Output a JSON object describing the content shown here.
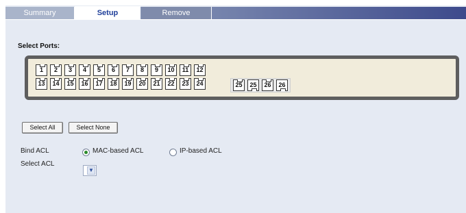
{
  "tabs": [
    {
      "label": "Summary",
      "active": false
    },
    {
      "label": "Setup",
      "active": true
    },
    {
      "label": "Remove",
      "active": false
    }
  ],
  "select_ports": {
    "title": "Select Ports:",
    "row1": [
      "1",
      "2",
      "3",
      "4",
      "5",
      "6",
      "7",
      "8",
      "9",
      "10",
      "11",
      "12"
    ],
    "row2": [
      "13",
      "14",
      "15",
      "16",
      "17",
      "18",
      "19",
      "20",
      "21",
      "22",
      "23",
      "24"
    ],
    "combo": [
      "25",
      "25",
      "26",
      "26"
    ]
  },
  "buttons": {
    "select_all": "Select All",
    "select_none": "Select None"
  },
  "bind_acl": {
    "label": "Bind ACL",
    "options": [
      {
        "label": "MAC-based ACL",
        "selected": true
      },
      {
        "label": "IP-based ACL",
        "selected": false
      }
    ]
  },
  "select_acl": {
    "label": "Select ACL",
    "value": ""
  },
  "colors": {
    "panel_bg": "#e5eaf3",
    "port_frame": "#5e5e5e",
    "port_bg": "#f1ecdb",
    "active_tab_text": "#1f3f9a"
  }
}
